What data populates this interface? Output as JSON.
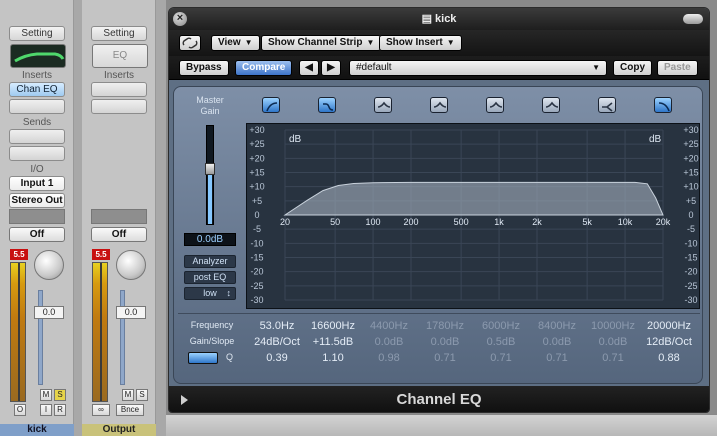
{
  "strips": [
    {
      "setting": "Setting",
      "inserts_label": "Inserts",
      "insert_slot": "Chan EQ",
      "sends_label": "Sends",
      "io_label": "I/O",
      "input": "Input 1",
      "output": "Stereo Out",
      "automation": "Off",
      "peak": "5.5",
      "fader": "0.0",
      "m": "M",
      "s": "S",
      "o": "O",
      "i": "I",
      "r": "R",
      "name": "kick"
    },
    {
      "setting": "Setting",
      "eq_label": "EQ",
      "inserts_label": "Inserts",
      "automation": "Off",
      "peak": "5.5",
      "fader": "0.0",
      "m": "M",
      "s": "S",
      "bnce": "Bnce",
      "name": "Output"
    }
  ],
  "window": {
    "title": "kick",
    "toolbar": {
      "view": "View",
      "show_channel_strip": "Show Channel Strip",
      "show_insert": "Show Insert",
      "bypass": "Bypass",
      "compare": "Compare",
      "prev": "◀",
      "next": "▶",
      "preset": "#default",
      "copy": "Copy",
      "paste": "Paste"
    },
    "master_gain_label": "Master Gain",
    "master_gain_value": "0.0dB",
    "master_gain_level": 0.56,
    "analyzer": "Analyzer",
    "post_eq": "post EQ",
    "resolution": "low",
    "plugin_name": "Channel EQ",
    "colors": {
      "panel": "#6c7d94",
      "graph_bg": "#283340",
      "curve_fill": "#9aa6b4",
      "active_blue": "#3d74c9"
    }
  },
  "chart_data": {
    "type": "area",
    "x_unit_label": "",
    "y_unit_label_left": "dB",
    "y_unit_label_right": "dB",
    "x_ticks": [
      "20",
      "50",
      "100",
      "200",
      "500",
      "1k",
      "2k",
      "5k",
      "10k",
      "20k"
    ],
    "x_tick_hz": [
      20,
      50,
      100,
      200,
      500,
      1000,
      2000,
      5000,
      10000,
      20000
    ],
    "x_scale": "log",
    "xlim": [
      20,
      20000
    ],
    "y_ticks": [
      "+30",
      "+25",
      "+20",
      "+15",
      "+10",
      "+5",
      "0",
      "-5",
      "-10",
      "-15",
      "-20",
      "-25",
      "-30"
    ],
    "y_tick_values": [
      30,
      25,
      20,
      15,
      10,
      5,
      0,
      -5,
      -10,
      -15,
      -20,
      -25,
      -30
    ],
    "ylim": [
      -30,
      30
    ],
    "grid": true,
    "curve": {
      "x": [
        20,
        30,
        40,
        53,
        70,
        100,
        200,
        1000,
        5000,
        12000,
        15000,
        17500,
        20000
      ],
      "y": [
        0,
        5.2,
        8.6,
        10.4,
        11.1,
        11.4,
        11.5,
        11.5,
        11.5,
        11.5,
        11.0,
        6.0,
        0
      ]
    }
  },
  "bands": {
    "frequency_label": "Frequency",
    "gain_label": "Gain/Slope",
    "q_label": "Q",
    "freq": [
      "53.0Hz",
      "16600Hz",
      "4400Hz",
      "1780Hz",
      "6000Hz",
      "8400Hz",
      "10000Hz",
      "20000Hz"
    ],
    "gain": [
      "24dB/Oct",
      "+11.5dB",
      "0.0dB",
      "0.0dB",
      "0.5dB",
      "0.0dB",
      "0.0dB",
      "12dB/Oct"
    ],
    "q": [
      "0.39",
      "1.10",
      "0.98",
      "0.71",
      "0.71",
      "0.71",
      "0.71",
      "0.88"
    ],
    "active": [
      true,
      true,
      false,
      false,
      false,
      false,
      false,
      true
    ],
    "icons": [
      "low-cut-icon",
      "low-shelf-icon",
      "bell-icon",
      "bell-icon",
      "bell-icon",
      "bell-icon",
      "high-shelf-icon",
      "high-cut-icon"
    ]
  }
}
